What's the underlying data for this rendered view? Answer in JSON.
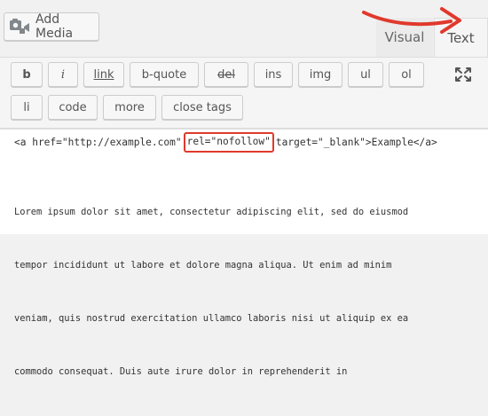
{
  "header": {
    "add_media_label": "Add Media",
    "add_media_icon": "media-camera-icon"
  },
  "tabs": [
    {
      "label": "Visual",
      "active": false
    },
    {
      "label": "Text",
      "active": true
    }
  ],
  "toolbar": {
    "buttons": [
      "b",
      "i",
      "link",
      "b-quote",
      "del",
      "ins",
      "img",
      "ul",
      "ol",
      "li",
      "code",
      "more",
      "close tags"
    ],
    "fullscreen_icon": "fullscreen-icon"
  },
  "editor": {
    "code_before": "<a href=\"http://example.com\"",
    "code_highlight": "rel=\"nofollow\"",
    "code_after": "target=\"_blank\">Example</a>",
    "lorem_lines": [
      "Lorem ipsum dolor sit amet, consectetur adipiscing elit, sed do eiusmod",
      "tempor incididunt ut labore et dolore magna aliqua. Ut enim ad minim",
      "veniam, quis nostrud exercitation ullamco laboris nisi ut aliquip ex ea",
      "commodo consequat. Duis aute irure dolor in reprehenderit in"
    ]
  },
  "annotation": {
    "arrow_color": "#e0392c",
    "highlight_color": "#e0392c"
  }
}
